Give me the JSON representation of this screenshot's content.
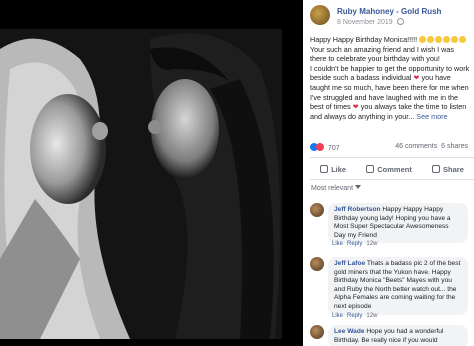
{
  "post": {
    "author": "Ruby Mahoney - Gold Rush",
    "date": "8 November 2019",
    "text_lines": [
      "Happy Happy Birthday Monica!!!!!",
      "Your such an amazing friend and I wish I was there to celebrate your birthday with you!",
      "I couldn't be happier to get the opportunity to work beside such a badass individual",
      "you have taught me so much, have been there for me when I've struggled and have laughed with me in the best of times",
      "you always take the time to listen and always do anything in your..."
    ],
    "see_more": "See more"
  },
  "reactions": {
    "count": "707",
    "comments": "46 comments",
    "shares": "6 shares"
  },
  "actions": {
    "like": "Like",
    "comment": "Comment",
    "share": "Share"
  },
  "comments_sort": "Most relevant",
  "comments": [
    {
      "name": "Jeff Robertson",
      "text": "Happy Happy Happy Birthday young lady! Hoping you have a Most Super Spectacular Awesomeness Day my Friend",
      "like": "Like",
      "reply": "Reply",
      "time": "12w"
    },
    {
      "name": "Jeff Lafoe",
      "text": "Thats a badass pic 2 of the best gold miners that the Yukon have. Happy Birthday Monica \"Beets\" Mayes with you and Ruby the North better watch out... the Alpha Females are coming waiting for the next episode",
      "like": "Like",
      "reply": "Reply",
      "time": "12w"
    },
    {
      "name": "Lee Wade",
      "text": "Hope you had a wonderful Birthday. Be really nice if you would"
    }
  ],
  "icons": {
    "globe": "globe-icon",
    "like": "thumbs-up-icon",
    "comment": "comment-icon",
    "share": "share-icon",
    "like_reaction": "like-reaction-icon",
    "love_reaction": "love-reaction-icon"
  },
  "colors": {
    "link": "#385898",
    "text": "#1c1e21",
    "muted": "#606770",
    "bubble": "#f2f3f5",
    "like_blue": "#1877f2",
    "love_red": "#f33e58"
  }
}
